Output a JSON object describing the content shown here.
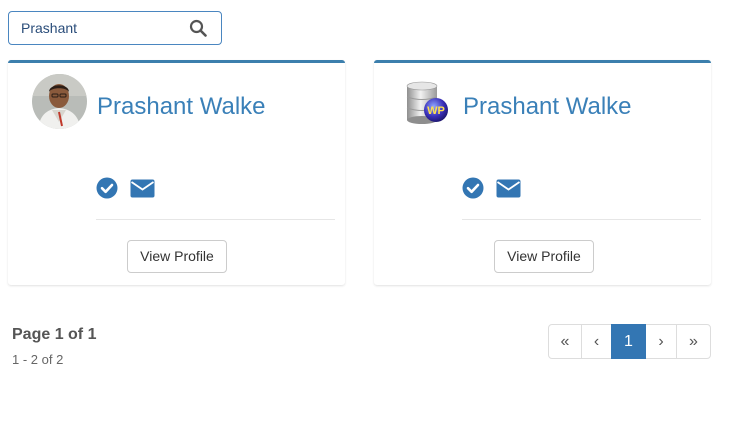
{
  "search": {
    "value": "Prashant",
    "icon": "search-icon"
  },
  "cards": [
    {
      "name": "Prashant Walke",
      "avatar": "user-photo",
      "button_label": "View Profile"
    },
    {
      "name": "Prashant Walke",
      "avatar": "database-icon",
      "button_label": "View Profile"
    }
  ],
  "pagination": {
    "title": "Page 1 of 1",
    "range": "1 - 2 of 2",
    "first": "«",
    "prev": "‹",
    "current": "1",
    "next": "›",
    "last": "»"
  },
  "colors": {
    "accent": "#3376b3",
    "link": "#3a80b8",
    "card_top": "#3c7fad"
  }
}
